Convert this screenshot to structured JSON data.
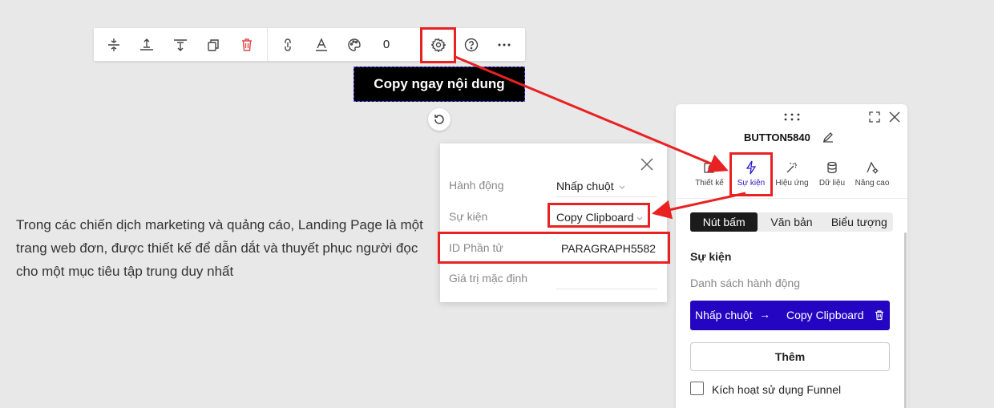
{
  "toolbar": {
    "buttons": [
      {
        "name": "align-middle-icon"
      },
      {
        "name": "align-top-icon"
      },
      {
        "name": "align-bottom-icon"
      },
      {
        "name": "duplicate-icon"
      },
      {
        "name": "delete-icon",
        "color": "#e04848"
      },
      {
        "name": "link-icon"
      },
      {
        "name": "text-style-icon"
      },
      {
        "name": "palette-icon"
      },
      {
        "name": "settings-icon"
      },
      {
        "name": "help-icon"
      },
      {
        "name": "more-icon"
      }
    ],
    "count": "0"
  },
  "canvas": {
    "button_label": "Copy ngay nội dung",
    "paragraph": "Trong các chiến dịch marketing và quảng cáo, Landing Page là một trang web đơn, được thiết kế để dẫn dắt và thuyết phục người đọc cho một mục tiêu tập trung duy nhất"
  },
  "popup": {
    "rows": [
      {
        "label": "Hành động",
        "value": "Nhấp chuột"
      },
      {
        "label": "Sự kiện",
        "value": "Copy Clipboard"
      },
      {
        "label": "ID Phần tử",
        "value": "PARAGRAPH5582"
      },
      {
        "label": "Giá trị mặc định",
        "value": ""
      }
    ]
  },
  "panel": {
    "title": "BUTTON5840",
    "tabs": [
      {
        "label": "Thiết kế",
        "icon": "edit-icon"
      },
      {
        "label": "Sự kiện",
        "icon": "lightning-icon",
        "active": true
      },
      {
        "label": "Hiệu ứng",
        "icon": "magic-wand-icon"
      },
      {
        "label": "Dữ liệu",
        "icon": "database-icon"
      },
      {
        "label": "Nâng cao",
        "icon": "advanced-settings-icon"
      }
    ],
    "segments": [
      {
        "label": "Nút bấm",
        "active": true
      },
      {
        "label": "Văn bản"
      },
      {
        "label": "Biểu tượng"
      }
    ],
    "section_title": "Sự kiện",
    "section_subtitle": "Danh sách hành động",
    "action": {
      "trigger": "Nhấp chuột",
      "arrow": "→",
      "result": "Copy Clipboard"
    },
    "add_label": "Thêm",
    "funnel_label": "Kích hoạt sử dụng Funnel",
    "funnel_checked": false
  },
  "colors": {
    "accent": "#2406c2",
    "highlight": "#e82222",
    "button_bg": "#000000"
  }
}
